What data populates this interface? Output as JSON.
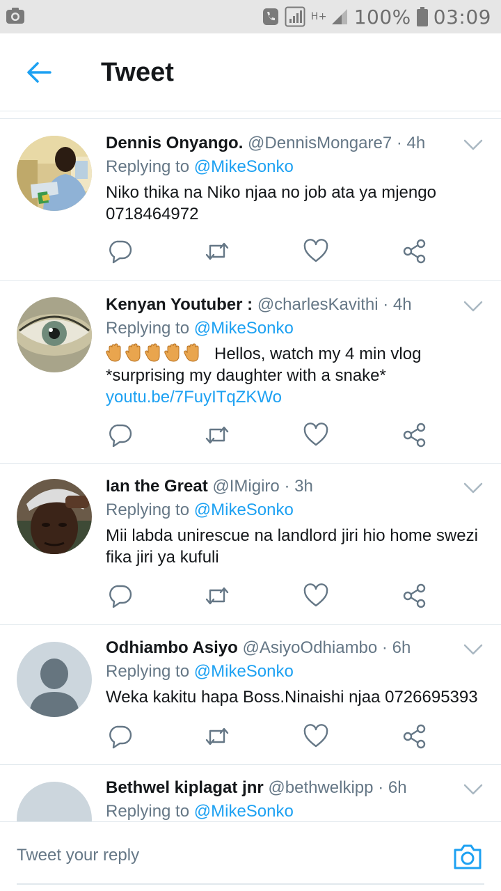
{
  "status_bar": {
    "battery": "100%",
    "time": "03:09",
    "network": "H+"
  },
  "header": {
    "title": "Tweet"
  },
  "tweets": [
    {
      "name": "Dennis Onyango.",
      "handle": "@DennisMongare7",
      "time": "4h",
      "reply_prefix": "Replying to",
      "reply_to": "@MikeSonko",
      "text_line1": "Niko thika na Niko njaa no job ata ya mjengo",
      "text_line2": "0718464972"
    },
    {
      "name": "Kenyan Youtuber :",
      "handle": "@charlesKavithi",
      "time": "4h",
      "reply_prefix": "Replying to",
      "reply_to": "@MikeSonko",
      "text_line1": "Hellos, watch my 4 min vlog",
      "text_line2": "*surprising  my daughter with a snake*",
      "link": "youtu.be/7FuyITqZKWo"
    },
    {
      "name": "Ian the Great",
      "handle": "@IMigiro",
      "time": "3h",
      "reply_prefix": "Replying to",
      "reply_to": "@MikeSonko",
      "text_line1": "Mii labda unirescue na landlord jiri hio home swezi",
      "text_line2": "fika jiri ya kufuli"
    },
    {
      "name": "Odhiambo Asiyo",
      "handle": "@AsiyoOdhiambo",
      "time": "6h",
      "reply_prefix": "Replying to",
      "reply_to": "@MikeSonko",
      "text_line1": "Weka kakitu hapa Boss.Ninaishi njaa 0726695393"
    },
    {
      "name": "Bethwel kiplagat jnr",
      "handle": "@bethwelkipp",
      "time": "6h",
      "reply_prefix": "Replying to",
      "reply_to": "@MikeSonko"
    }
  ],
  "reply_bar": {
    "placeholder": "Tweet your reply"
  },
  "icons": {
    "status_bar": [
      "screenshot-icon",
      "phone-icon",
      "signal-icon",
      "battery-icon"
    ],
    "actions": [
      "reply-icon",
      "retweet-icon",
      "like-icon",
      "share-icon"
    ],
    "reply_bar": "camera-icon"
  },
  "colors": {
    "accent": "#1da1f2",
    "secondary_text": "#657786",
    "primary_text": "#14171a",
    "divider": "#e1e8ed"
  }
}
